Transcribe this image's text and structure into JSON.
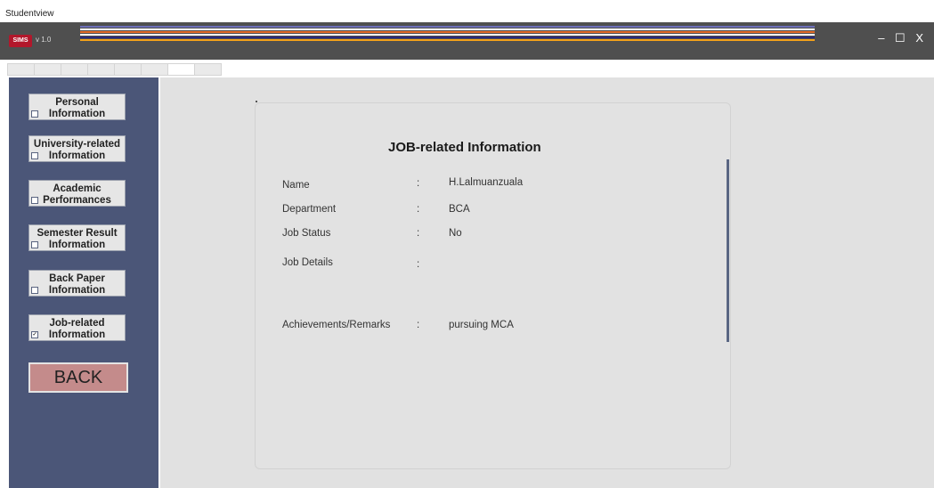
{
  "window": {
    "os_title": "Studentview",
    "logo_text": "SIMS",
    "version": "v 1.0",
    "minimize": "–",
    "maximize": "☐",
    "close": "X",
    "stripe_colors": [
      "#6d6fb8",
      "#ffffff",
      "#e36b26",
      "#ffffff",
      "#2a2a7a",
      "#f2a11a"
    ]
  },
  "sidebar": {
    "items": [
      {
        "line1": "Personal",
        "line2": "Information",
        "checked": false
      },
      {
        "line1": "University-related",
        "line2": "Information",
        "checked": false
      },
      {
        "line1": "Academic",
        "line2": "Performances",
        "checked": false
      },
      {
        "line1": "Semester Result",
        "line2": "Information",
        "checked": false
      },
      {
        "line1": "Back Paper",
        "line2": "Information",
        "checked": false
      },
      {
        "line1": "Job-related",
        "line2": "Information",
        "checked": true
      }
    ],
    "back_label": "BACK"
  },
  "panel": {
    "title": "JOB-related Information",
    "fields": [
      {
        "label": "Name",
        "colon": ":",
        "value": "H.Lalmuanzuala"
      },
      {
        "label": "Department",
        "colon": ":",
        "value": "BCA"
      },
      {
        "label": "Job Status",
        "colon": ":",
        "value": "No"
      },
      {
        "label": "Job Details",
        "colon": ":",
        "value": ""
      },
      {
        "label": "Achievements/Remarks",
        "colon": ":",
        "value": "pursuing MCA"
      }
    ]
  },
  "colors": {
    "sidebar": "#4b5678",
    "back_button": "#c48b8b",
    "titlebar": "#4f4f4f",
    "logo": "#b2172b"
  }
}
